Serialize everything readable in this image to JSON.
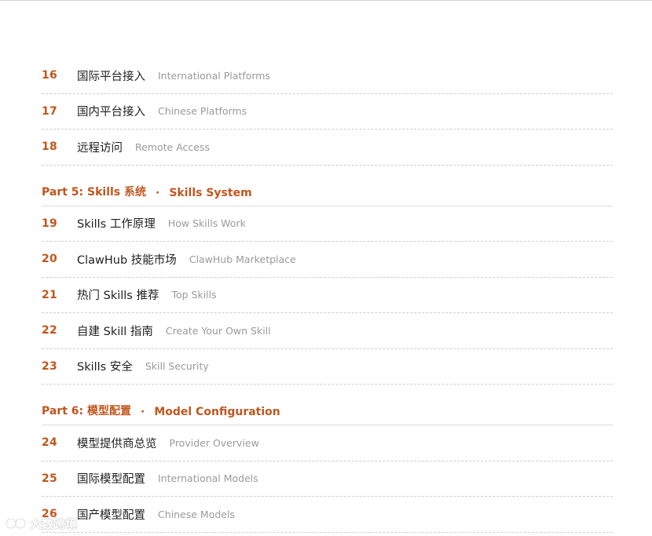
{
  "sections": [
    {
      "type": "items",
      "items": [
        {
          "num": "16",
          "zh": "国际平台接入",
          "en": "International Platforms"
        },
        {
          "num": "17",
          "zh": "国内平台接入",
          "en": "Chinese Platforms"
        },
        {
          "num": "18",
          "zh": "远程访问",
          "en": "Remote Access"
        }
      ]
    },
    {
      "type": "part",
      "label": "Part 5: Skills 系统",
      "dot": "·",
      "en": "Skills System"
    },
    {
      "type": "items",
      "items": [
        {
          "num": "19",
          "zh": "Skills 工作原理",
          "en": "How Skills Work"
        },
        {
          "num": "20",
          "zh": "ClawHub 技能市场",
          "en": "ClawHub Marketplace"
        },
        {
          "num": "21",
          "zh": "热门 Skills 推荐",
          "en": "Top Skills"
        },
        {
          "num": "22",
          "zh": "自建 Skill 指南",
          "en": "Create Your Own Skill"
        },
        {
          "num": "23",
          "zh": "Skills 安全",
          "en": "Skill Security"
        }
      ]
    },
    {
      "type": "part",
      "label": "Part 6: 模型配置",
      "dot": "·",
      "en": "Model Configuration"
    },
    {
      "type": "items",
      "items": [
        {
          "num": "24",
          "zh": "模型提供商总览",
          "en": "Provider Overview"
        },
        {
          "num": "25",
          "zh": "国际模型配置",
          "en": "International Models"
        },
        {
          "num": "26",
          "zh": "国产模型配置",
          "en": "Chinese Models"
        }
      ]
    }
  ],
  "watermark": {
    "text": "大数跨境",
    "icon": "watermark-logo-icon"
  },
  "colors": {
    "accent": "#c0561d",
    "title_text": "#1f1f1f",
    "subtitle_text": "#9a9a9a",
    "rule": "#cfcfcf"
  }
}
